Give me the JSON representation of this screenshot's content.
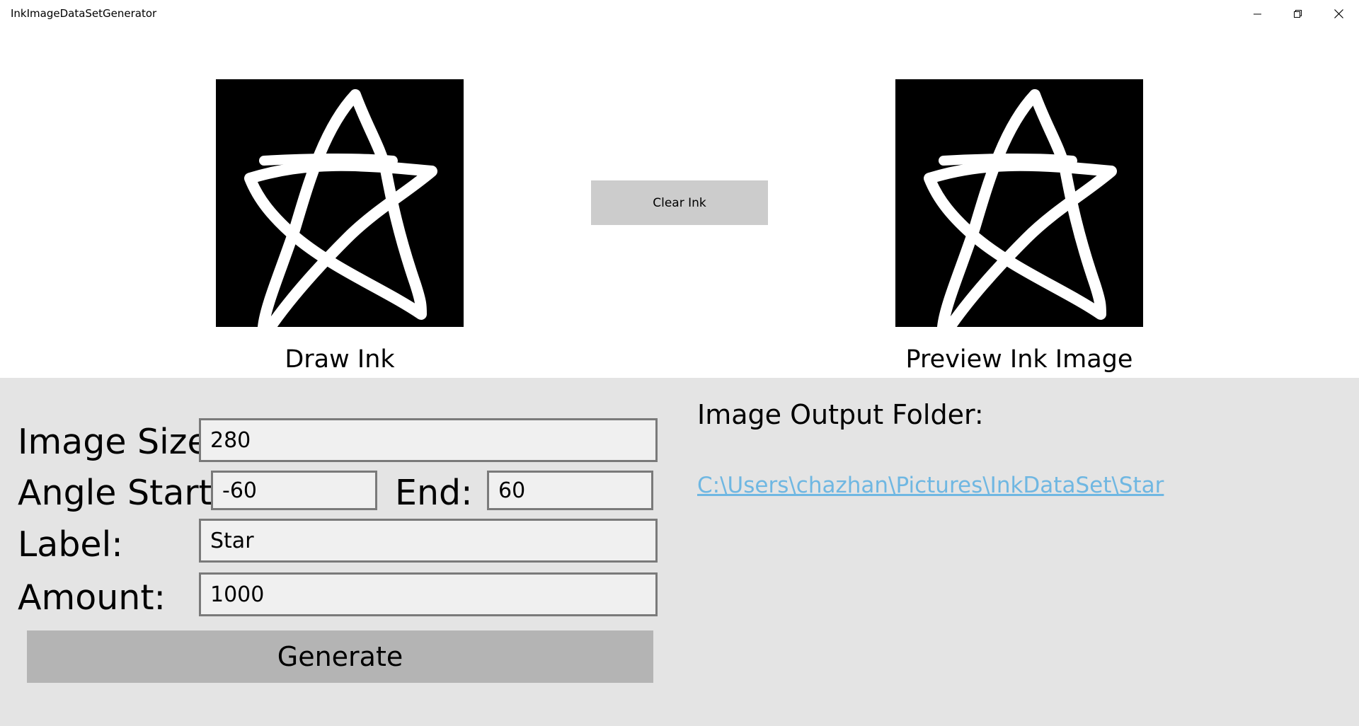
{
  "window": {
    "title": "InkImageDataSetGenerator",
    "controls": {
      "minimize_icon": "minimize-icon",
      "restore_icon": "restore-icon",
      "close_icon": "close-icon"
    }
  },
  "ink": {
    "draw_label": "Draw Ink",
    "preview_label": "Preview Ink Image",
    "clear_button": "Clear Ink",
    "canvas_background": "#000000",
    "stroke_color": "#ffffff"
  },
  "form": {
    "image_size_label": "Image Size:",
    "image_size_value": "280",
    "angle_start_label": "Angle Start:",
    "angle_start_value": "-60",
    "angle_end_label": "End:",
    "angle_end_value": "60",
    "label_label": "Label:",
    "label_value": "Star",
    "amount_label": "Amount:",
    "amount_value": "1000",
    "generate_button": "Generate"
  },
  "output": {
    "heading": "Image Output Folder:",
    "path": "C:\\Users\\chazhan\\Pictures\\InkDataSet\\Star",
    "link_color": "#6fb7e2"
  }
}
